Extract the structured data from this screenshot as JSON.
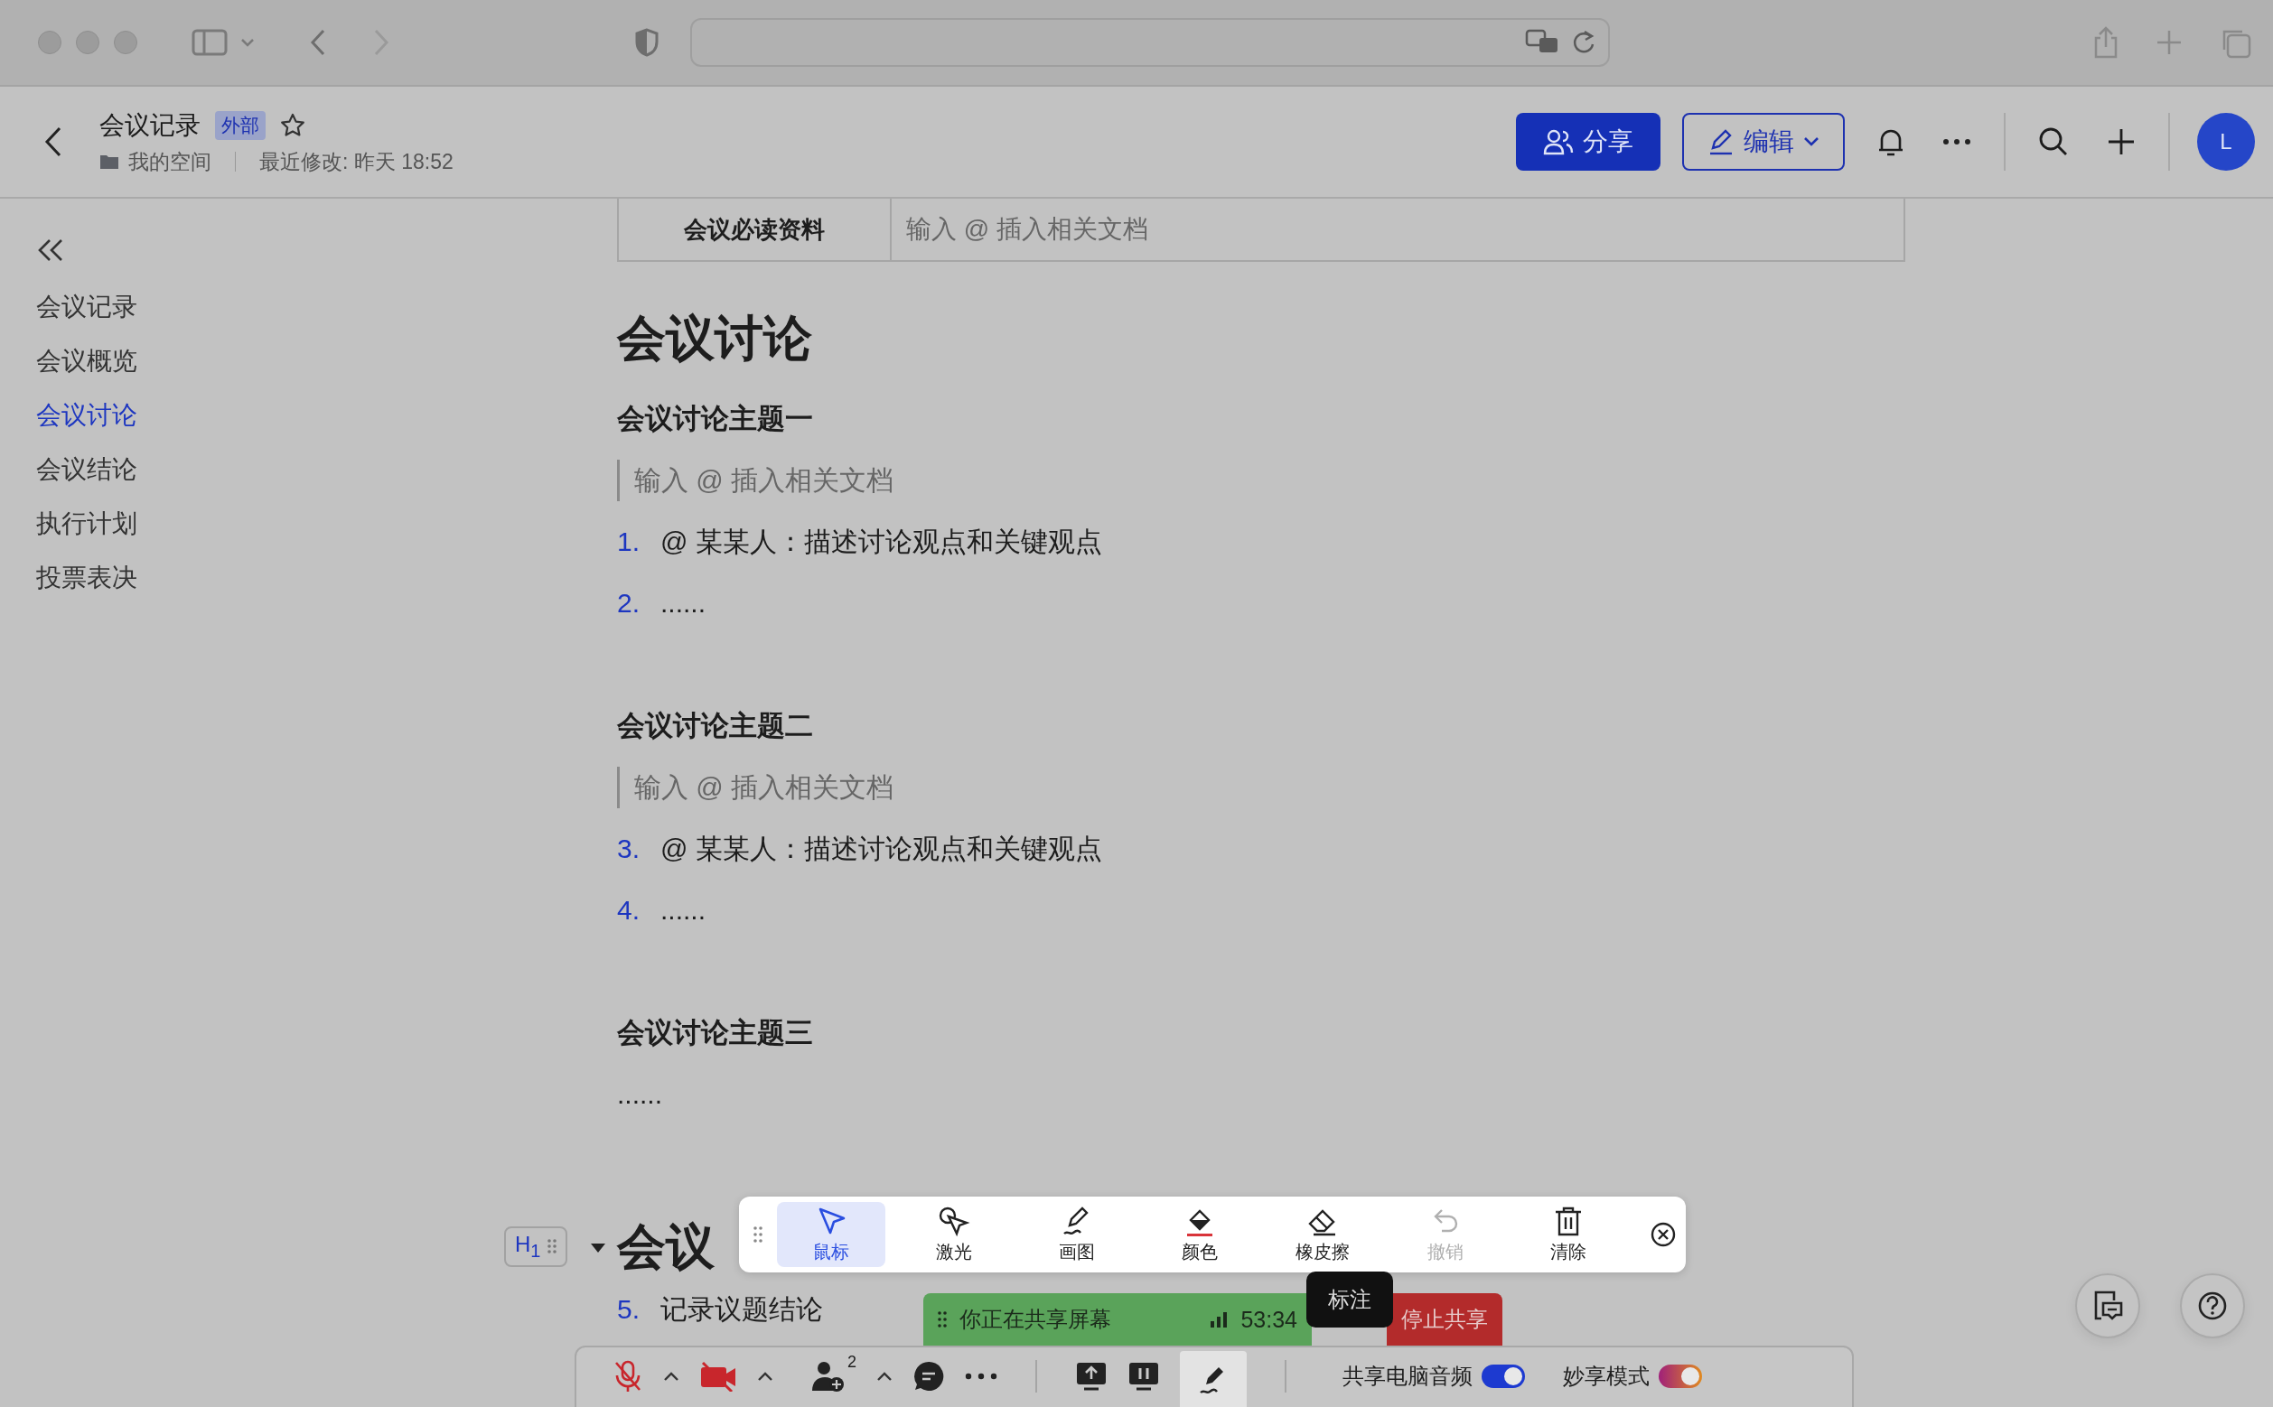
{
  "header": {
    "title": "会议记录",
    "badge": "外部",
    "folder": "我的空间",
    "modified": "最近修改: 昨天 18:52",
    "share_button": "分享",
    "edit_button": "编辑",
    "avatar": "L"
  },
  "sidebar": {
    "items": [
      {
        "label": "会议记录",
        "selected": false
      },
      {
        "label": "会议概览",
        "selected": false
      },
      {
        "label": "会议讨论",
        "selected": true
      },
      {
        "label": "会议结论",
        "selected": false
      },
      {
        "label": "执行计划",
        "selected": false
      },
      {
        "label": "投票表决",
        "selected": false
      }
    ]
  },
  "document": {
    "table_row": {
      "label": "会议必读资料",
      "placeholder": "输入 @ 插入相关文档"
    },
    "blocks": [
      {
        "kind": "h1",
        "text": "会议讨论"
      },
      {
        "kind": "h3",
        "text": "会议讨论主题一"
      },
      {
        "kind": "quote",
        "text": "输入 @ 插入相关文档"
      },
      {
        "kind": "list_item",
        "number": "1.",
        "text": "@ 某某人：描述讨论观点和关键观点"
      },
      {
        "kind": "list_item",
        "number": "2.",
        "text": "......"
      },
      {
        "kind": "h3",
        "text": "会议讨论主题二"
      },
      {
        "kind": "quote",
        "text": "输入 @ 插入相关文档"
      },
      {
        "kind": "list_item",
        "number": "3.",
        "text": "@ 某某人：描述讨论观点和关键观点"
      },
      {
        "kind": "list_item",
        "number": "4.",
        "text": "......"
      },
      {
        "kind": "h3",
        "text": "会议讨论主题三"
      },
      {
        "kind": "paragraph",
        "text": "......"
      },
      {
        "kind": "h1",
        "text": "会议",
        "handle": "H$_{1}$"
      },
      {
        "kind": "list_item",
        "number": "5.",
        "text": "记录议题结论"
      }
    ]
  },
  "annotation_toolbar": {
    "tools": [
      {
        "kind": "pointer",
        "label": "鼠标",
        "selected": true,
        "disabled": false
      },
      {
        "kind": "laser",
        "label": "激光",
        "selected": false,
        "disabled": false
      },
      {
        "kind": "pen",
        "label": "画图",
        "selected": false,
        "disabled": false
      },
      {
        "kind": "color",
        "label": "颜色",
        "selected": false,
        "disabled": false
      },
      {
        "kind": "eraser",
        "label": "橡皮擦",
        "selected": false,
        "disabled": false
      },
      {
        "kind": "undo",
        "label": "撤销",
        "selected": false,
        "disabled": true
      },
      {
        "kind": "clear",
        "label": "清除",
        "selected": false,
        "disabled": false
      }
    ]
  },
  "share_bar": {
    "status": "你正在共享屏幕",
    "time": "53:34",
    "stop_button": "停止共享",
    "tooltip": "标注"
  },
  "meeting_bar": {
    "mic_muted": true,
    "camera_off": true,
    "participants": "2",
    "annotate_active": true,
    "toggles": [
      {
        "kind": "standard",
        "label": "共享电脑音频",
        "on": true
      },
      {
        "kind": "gradient",
        "label": "妙享模式",
        "on": true
      }
    ]
  }
}
